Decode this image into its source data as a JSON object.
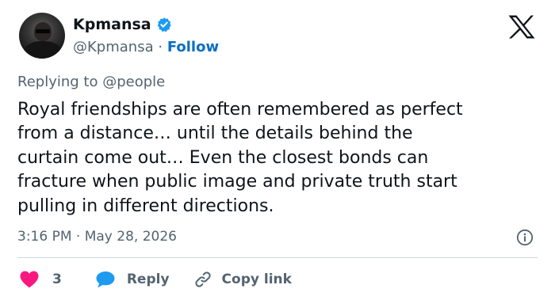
{
  "author": {
    "display_name": "Kpmansa",
    "handle": "@Kpmansa",
    "separator": "·",
    "follow_label": "Follow"
  },
  "reply_to": "Replying to @people",
  "tweet_lines": [
    "Royal friendships are often remembered as perfect",
    "from a distance… until the details behind the",
    "curtain come out… Even the closest bonds can",
    "fracture when public image and private truth start",
    "pulling in different directions."
  ],
  "timestamp": "3:16 PM · May 28, 2026",
  "actions": {
    "like_count": "3",
    "reply_label": "Reply",
    "copy_label": "Copy link"
  },
  "colors": {
    "text": "#0f1419",
    "secondary": "#536471",
    "link": "#0a6fc2",
    "verified": "#1d9bf0",
    "like": "#f91880",
    "reply_bubble": "#1d9bf0",
    "divider": "#cfd9de"
  },
  "icons": [
    "verified-badge-icon",
    "x-logo-icon",
    "info-icon",
    "heart-icon",
    "reply-bubble-icon",
    "link-icon"
  ]
}
